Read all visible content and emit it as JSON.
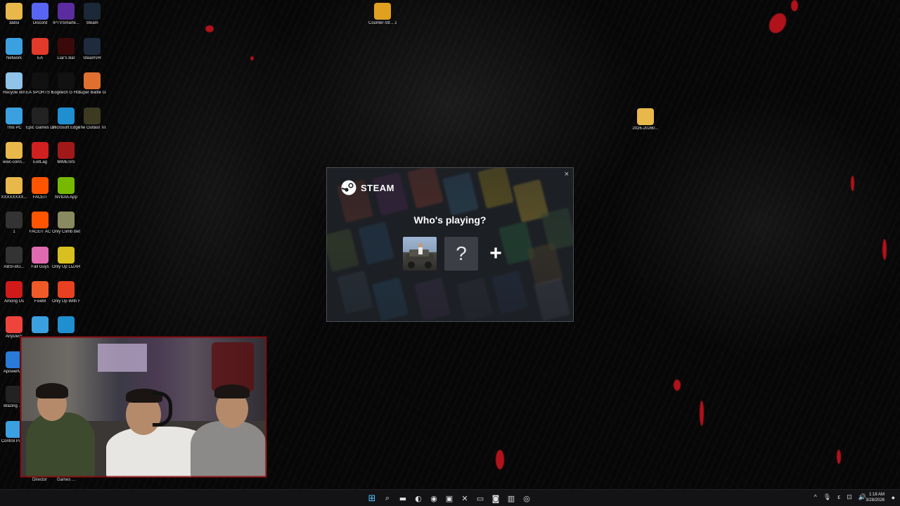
{
  "desktop": {
    "icons": [
      {
        "label": "3absi",
        "icon": "folder-icon",
        "color": "#e8b84a"
      },
      {
        "label": "Discord",
        "icon": "discord-icon",
        "color": "#5865f2"
      },
      {
        "label": "IPTVSmarte...",
        "icon": "iptv-icon",
        "color": "#5a2ca0"
      },
      {
        "label": "Steam",
        "icon": "steam-icon",
        "color": "#1b2838"
      },
      {
        "label": "Network",
        "icon": "network-icon",
        "color": "#3aa0e0"
      },
      {
        "label": "EA",
        "icon": "ea-icon",
        "color": "#e23a2a"
      },
      {
        "label": "Liar's Bar",
        "icon": "liars-bar-icon",
        "color": "#3a0a0a"
      },
      {
        "label": "SteamVR",
        "icon": "steamvr-icon",
        "color": "#1d2b3c"
      },
      {
        "label": "Recycle Bin",
        "icon": "recycle-bin-icon",
        "color": "#8fc3e8"
      },
      {
        "label": "EA SPORTS FC™ 26",
        "icon": "ea-sports-fc-icon",
        "color": "#111111"
      },
      {
        "label": "Logitech G HUB",
        "icon": "logitech-icon",
        "color": "#111111"
      },
      {
        "label": "Super Battle Golf",
        "icon": "super-battle-golf-icon",
        "color": "#e07030"
      },
      {
        "label": "This PC",
        "icon": "this-pc-icon",
        "color": "#3aa0e0"
      },
      {
        "label": "Epic Games Launcher",
        "icon": "epic-games-icon",
        "color": "#222222"
      },
      {
        "label": "Microsoft Edge",
        "icon": "edge-icon",
        "color": "#1f8fd0"
      },
      {
        "label": "The Outlast Trials",
        "icon": "outlast-icon",
        "color": "#3c3a20"
      },
      {
        "label": "wwc-conn...",
        "icon": "folder-icon",
        "color": "#e8b84a"
      },
      {
        "label": "ExitLag",
        "icon": "exitlag-icon",
        "color": "#d02020"
      },
      {
        "label": "MIMESIS",
        "icon": "mimesis-icon",
        "color": "#a01818"
      },
      {
        "label": "XXXXXXXX...",
        "icon": "folder-icon",
        "color": "#e8b84a"
      },
      {
        "label": "FACEIT",
        "icon": "faceit-icon",
        "color": "#ff5500"
      },
      {
        "label": "NVIDIA App",
        "icon": "nvidia-icon",
        "color": "#76b900"
      },
      {
        "label": "1",
        "icon": "game-shortcut-icon",
        "color": "#333333"
      },
      {
        "label": "FACEIT AC",
        "icon": "faceit-ac-icon",
        "color": "#ff5500"
      },
      {
        "label": "Only Climb Better To...",
        "icon": "only-climb-icon",
        "color": "#8a8a60"
      },
      {
        "label": "ABSI-BG...",
        "icon": "game-shortcut-icon",
        "color": "#333333"
      },
      {
        "label": "Fall Guys",
        "icon": "fall-guys-icon",
        "color": "#e06ab0"
      },
      {
        "label": "Only Up LIZARDS ...",
        "icon": "only-up-lizards-icon",
        "color": "#d8c020"
      },
      {
        "label": "Among Us",
        "icon": "among-us-icon",
        "color": "#d01a1a"
      },
      {
        "label": "FiveM",
        "icon": "fivem-icon",
        "color": "#f05a28"
      },
      {
        "label": "Only Up With Friends",
        "icon": "only-up-friends-icon",
        "color": "#e84020"
      },
      {
        "label": "AnyDesk",
        "icon": "anydesk-icon",
        "color": "#ef443b"
      },
      {
        "label": "",
        "icon": "app-shortcut-icon",
        "color": "#3aa0e0"
      },
      {
        "label": "",
        "icon": "edge-icon",
        "color": "#1f8fd0"
      },
      {
        "label": "ApowerM...",
        "icon": "apowermirror-icon",
        "color": "#2a7ad8"
      },
      {
        "label": "Blazing 7...",
        "icon": "blazing-icon",
        "color": "#222222"
      },
      {
        "label": "Control Panel",
        "icon": "control-panel-icon",
        "color": "#3aa0e0"
      },
      {
        "label": "Counter-Str... 2",
        "icon": "counter-strike-icon",
        "color": "#e0a020"
      },
      {
        "label": "2026-20260...",
        "icon": "folder-icon",
        "color": "#e8b84a"
      }
    ],
    "under_cam_labels": [
      "Director",
      "Games ..."
    ]
  },
  "steam_dialog": {
    "brand": "STEAM",
    "close_glyph": "×",
    "title": "Who's playing?",
    "unknown_glyph": "?",
    "add_glyph": "+"
  },
  "taskbar": {
    "start_glyph": "⊞",
    "apps": [
      {
        "icon": "search-icon",
        "glyph": "⌕"
      },
      {
        "icon": "file-explorer-icon",
        "glyph": "▬"
      },
      {
        "icon": "edge-icon",
        "glyph": "◐"
      },
      {
        "icon": "chrome-icon",
        "glyph": "◉"
      },
      {
        "icon": "store-icon",
        "glyph": "▣"
      },
      {
        "icon": "xbox-icon",
        "glyph": "✕"
      },
      {
        "icon": "mail-icon",
        "glyph": "▭"
      },
      {
        "icon": "discord-icon",
        "glyph": "◙"
      },
      {
        "icon": "app-icon",
        "glyph": "▥"
      },
      {
        "icon": "steam-icon",
        "glyph": "◎"
      }
    ],
    "tray": [
      "^",
      "🎙",
      "ε",
      "⊡",
      "🔊"
    ],
    "time": "1:18 AM",
    "date": "3/28/2026"
  }
}
